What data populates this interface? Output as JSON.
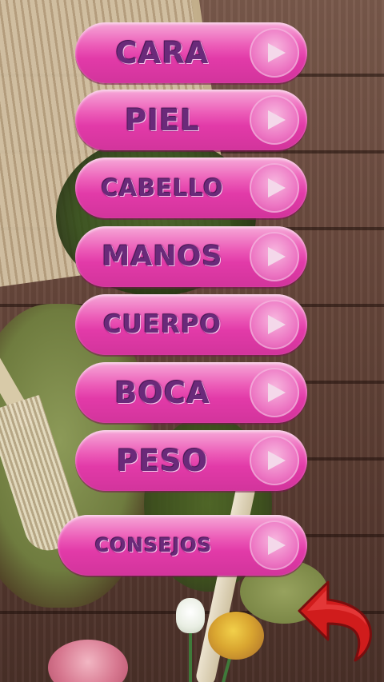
{
  "menu": {
    "items": [
      {
        "label": "CARA"
      },
      {
        "label": "PIEL"
      },
      {
        "label": "CABELLO"
      },
      {
        "label": "MANOS"
      },
      {
        "label": "CUERPO"
      },
      {
        "label": "BOCA"
      },
      {
        "label": "PESO"
      },
      {
        "label": "CONSEJOS"
      }
    ],
    "play_icon": "play-icon"
  },
  "back_icon": "back-arrow-icon",
  "colors": {
    "button_pink": "#e23aa8",
    "label_purple": "#6a2a7a",
    "back_arrow_red": "#d01c1c"
  }
}
